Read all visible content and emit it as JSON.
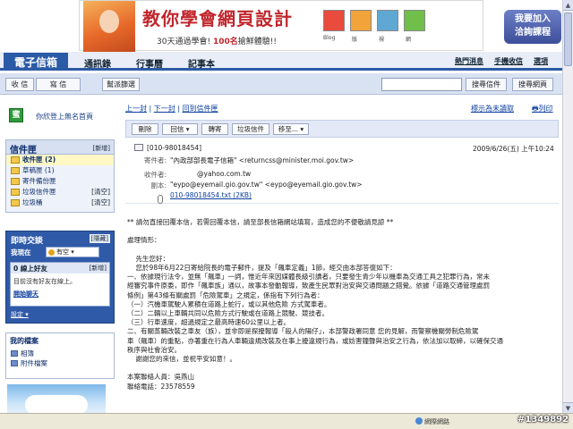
{
  "banner": {
    "title": "教你學會網頁設計",
    "sub_prefix": "30天通過學會!",
    "sub_highlight": "100名",
    "sub_suffix": "搶鮮體驗!!",
    "icon_captions": [
      "Blog",
      "版",
      "視",
      "網"
    ],
    "cta_line1": "我要加入",
    "cta_line2": "洽詢課程"
  },
  "tabs": [
    "電子信箱",
    "通訊錄",
    "行事曆",
    "記事本"
  ],
  "top_links": [
    "熱門消息",
    "手機收信",
    "選項"
  ],
  "toolbar": {
    "receive": "收 信",
    "compose": "寫 信",
    "spam": "幫派篩選",
    "search_mail": "搜尋信件",
    "search_web": "搜尋網頁"
  },
  "user": {
    "greeting": "你欣登上無名首頁"
  },
  "folders": {
    "title": "信件匣",
    "new_label": "[新增]",
    "items": [
      {
        "label": "收件匣 (2)",
        "extra": ""
      },
      {
        "label": "草稿匣 (1)",
        "extra": ""
      },
      {
        "label": "寄件備份匣",
        "extra": ""
      },
      {
        "label": "垃圾信件匣",
        "extra": "[清空]"
      },
      {
        "label": "垃圾桶",
        "extra": "[清空]"
      }
    ]
  },
  "chat": {
    "title": "即時交談",
    "hide": "[隱藏]",
    "status_label": "我現在",
    "status_value": "有空",
    "friends_head": "0 線上好友",
    "friends_new": "[新增]",
    "empty_text": "目前沒有好友在線上。",
    "start_link": "開始聊天",
    "settings": "設定 ▾"
  },
  "files": {
    "title": "我的檔案",
    "items": [
      "相簿",
      "附件檔案"
    ]
  },
  "nav": {
    "prev": "上一封",
    "next": "下一封",
    "back": "回到信件匣",
    "mark_unread": "標示為未讀取",
    "print": "列印"
  },
  "actions": [
    "刪除",
    "回信 ▾",
    "轉寄",
    "垃圾信件",
    "移至... ▾"
  ],
  "mail": {
    "id": "[010-98018454]",
    "date": "2009/6/26(五) 上午10:24",
    "from_label": "寄件者:",
    "from_value": "\"內政部部長電子信箱\" <returncss@minister.moi.gov.tw>",
    "to_label": "收件者:",
    "to_value": "@yahoo.com.tw",
    "cc_label": "副本:",
    "cc_value": "\"eypo@eyemail.gio.gov.tw\" <eypo@eyemail.gio.gov.tw>",
    "attachment": "010-98018454.txt (2KB)"
  },
  "body": "** 請勿直接回覆本信，若需回覆本信，請至部長信箱網站填寫，造成您的不便敬請見諒 **\n\n處理情形：\n\n    先生您好：\n    您於98年6月22日寄給院長的電子郵件，提及「飆車定義」1節，經交由本部答復如下：\n一、依據現行法令，並無「飆車」一詞，惟近年來因媒體長級引讀者，只要發生青少年以機車為交通工具之犯罪行為，常未\n經審究事件原委，即作「飆車族」通以，故事本發動報導，致產生民眾對治安與交通問題之錯覺。依據「道路交通管理處罰\n條例」第43條有關處罰「危險駕車」之規定，係指有下列行為者：\n（一）汽機車駕駛人累積在道路上蛇行，或以其他危險 方式駕車者。\n（二）二輛以上車輛共同以危險方式行駛或在道路上競駛、競技者。\n（三）行車速度，超過規定之最高時速60公里以上者。\n二、有關蒸輛改裝之車友（族），並非即是探擾報導「殺人的陽仔」，本部警政署同意 您的見解，而警察機關勞制危險駕\n車（飆車）的重點，亦著重在行為人車輛違規改裝及在事上擾違規行為，或妨害鐘聲與治安之行為，依法加以取締，以確保交通\n秩序與社會治安。\n    謝謝您的來信，並祝平安如意！。\n\n本案聯絡人員：吳燕山\n聯絡電話：23578559",
  "statusbar": {
    "zone": "網際網路"
  },
  "watermark": "#1349892"
}
